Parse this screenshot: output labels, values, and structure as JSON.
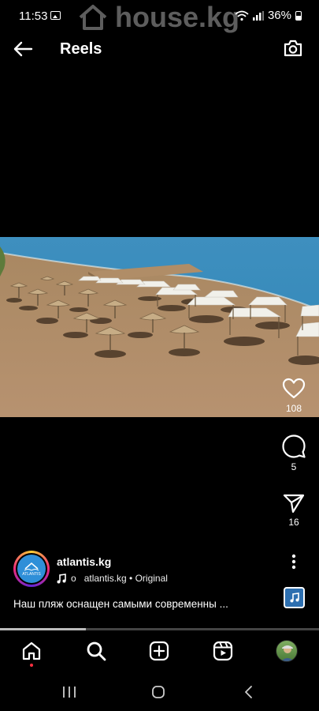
{
  "status_bar": {
    "time": "11:53",
    "battery_percent": "36%",
    "watermark": "house.kg"
  },
  "header": {
    "title": "Reels"
  },
  "actions": {
    "likes": "108",
    "comments": "5",
    "shares": "16"
  },
  "author": {
    "username": "atlantis.kg",
    "avatar_label": "ATLANTIS",
    "audio_prefix": "о",
    "audio_text": "atlantis.kg • Original"
  },
  "caption": "Наш пляж оснащен  самыми современны ...",
  "progress": 0.27,
  "colors": {
    "background": "#000000",
    "notification_dot": "#ff3040",
    "audio_thumb": "#2d6fb0"
  },
  "icons": {
    "back": "arrow-left-icon",
    "camera": "camera-icon",
    "like": "heart-icon",
    "comment": "comment-bubble-icon",
    "share": "paper-plane-icon",
    "more": "vertical-dots-icon",
    "audio": "music-note-icon",
    "nav": [
      "home-icon",
      "search-icon",
      "add-post-icon",
      "reels-icon",
      "profile-avatar"
    ],
    "system": [
      "recents-icon",
      "home-circle-icon",
      "back-chevron-icon"
    ]
  }
}
